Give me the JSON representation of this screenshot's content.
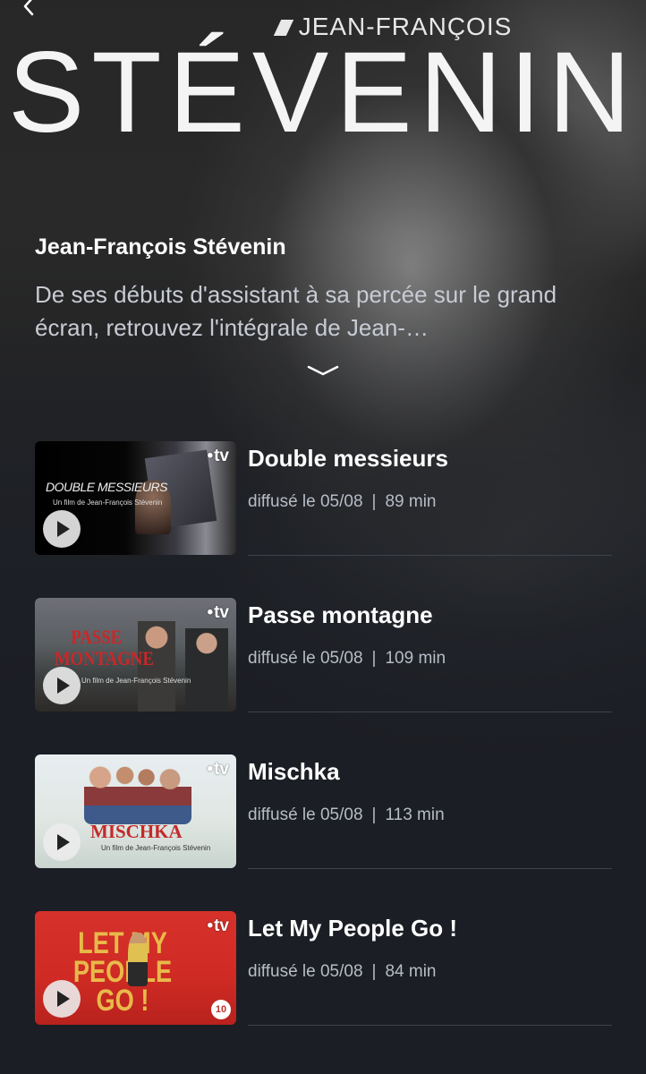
{
  "header": {
    "logo_sub": "JEAN-FRANÇOIS",
    "logo_main": "STÉVENIN"
  },
  "intro": {
    "title": "Jean-François Stévenin",
    "description": "De ses débuts d'assistant à sa percée sur le grand écran, retrouvez l'intégrale de Jean-…"
  },
  "icons": {
    "back": "chevron-left-icon",
    "expand": "chevron-down-icon",
    "play": "play-icon"
  },
  "items": [
    {
      "title": "Double messieurs",
      "date": "diffusé le 05/08",
      "duration": "89 min",
      "thumb_title": "DOUBLE MESSIEURS",
      "thumb_sub": "Un film de Jean-François Stévenin",
      "channel": "tv"
    },
    {
      "title": "Passe montagne",
      "date": "diffusé le 05/08",
      "duration": "109 min",
      "thumb_title": "PASSE MONTAGNE",
      "thumb_sub": "Un film de Jean-François Stévenin",
      "channel": "tv"
    },
    {
      "title": "Mischka",
      "date": "diffusé le 05/08",
      "duration": "113 min",
      "thumb_title": "MISCHKA",
      "thumb_sub": "Un film de Jean-François Stévenin",
      "channel": "tv"
    },
    {
      "title": "Let My People Go !",
      "date": "diffusé le 05/08",
      "duration": "84 min",
      "thumb_title": "LET MY PEOPLE GO !",
      "thumb_badge": "10",
      "channel": "tv"
    }
  ],
  "separator": "|"
}
